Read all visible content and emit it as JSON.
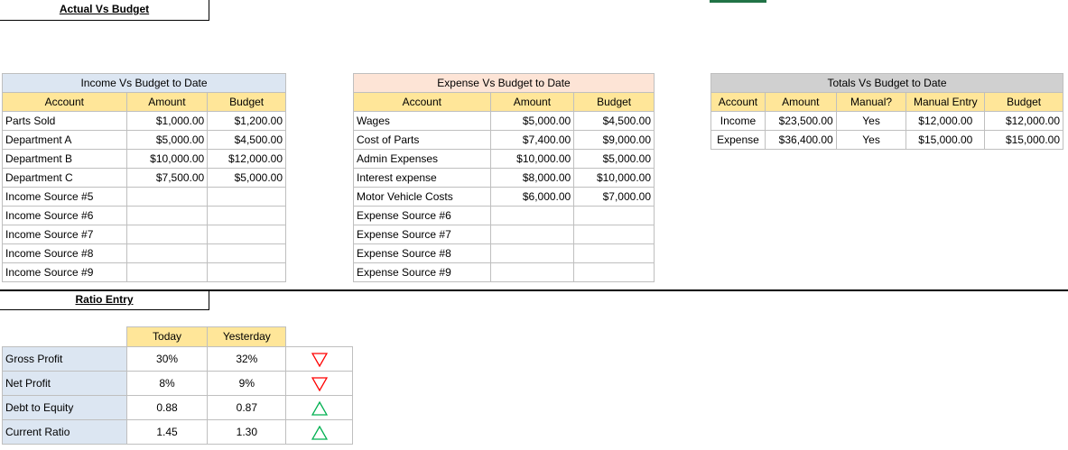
{
  "titles": {
    "actual_vs_budget": "Actual Vs Budget",
    "ratio_entry": "Ratio Entry"
  },
  "income": {
    "title": "Income Vs Budget to Date",
    "headers": [
      "Account",
      "Amount",
      "Budget"
    ],
    "rows": [
      [
        "Parts Sold",
        "$1,000.00",
        "$1,200.00"
      ],
      [
        "Department A",
        "$5,000.00",
        "$4,500.00"
      ],
      [
        "Department B",
        "$10,000.00",
        "$12,000.00"
      ],
      [
        "Department C",
        "$7,500.00",
        "$5,000.00"
      ],
      [
        "Income Source #5",
        "",
        ""
      ],
      [
        "Income Source #6",
        "",
        ""
      ],
      [
        "Income Source #7",
        "",
        ""
      ],
      [
        "Income Source #8",
        "",
        ""
      ],
      [
        "Income Source #9",
        "",
        ""
      ]
    ]
  },
  "expense": {
    "title": "Expense Vs Budget to Date",
    "headers": [
      "Account",
      "Amount",
      "Budget"
    ],
    "rows": [
      [
        "Wages",
        "$5,000.00",
        "$4,500.00"
      ],
      [
        "Cost of Parts",
        "$7,400.00",
        "$9,000.00"
      ],
      [
        "Admin Expenses",
        "$10,000.00",
        "$5,000.00"
      ],
      [
        "Interest expense",
        "$8,000.00",
        "$10,000.00"
      ],
      [
        "Motor Vehicle Costs",
        "$6,000.00",
        "$7,000.00"
      ],
      [
        "Expense Source #6",
        "",
        ""
      ],
      [
        "Expense Source #7",
        "",
        ""
      ],
      [
        "Expense Source #8",
        "",
        ""
      ],
      [
        "Expense Source #9",
        "",
        ""
      ]
    ]
  },
  "totals": {
    "title": "Totals Vs Budget to Date",
    "headers": [
      "Account",
      "Amount",
      "Manual?",
      "Manual Entry",
      "Budget"
    ],
    "rows": [
      [
        "Income",
        "$23,500.00",
        "Yes",
        "$12,000.00",
        "$12,000.00"
      ],
      [
        "Expense",
        "$36,400.00",
        "Yes",
        "$15,000.00",
        "$15,000.00"
      ]
    ]
  },
  "ratios": {
    "headers": [
      "Today",
      "Yesterday"
    ],
    "rows": [
      {
        "label": "Gross Profit",
        "today": "30%",
        "yesterday": "32%",
        "trend": "down"
      },
      {
        "label": "Net Profit",
        "today": "8%",
        "yesterday": "9%",
        "trend": "down"
      },
      {
        "label": "Debt to Equity",
        "today": "0.88",
        "yesterday": "0.87",
        "trend": "up"
      },
      {
        "label": "Current Ratio",
        "today": "1.45",
        "yesterday": "1.30",
        "trend": "up"
      }
    ]
  },
  "colors": {
    "trend_down": "#ff0000",
    "trend_up": "#00b050",
    "header_yellow": "#ffe699",
    "income_blue": "#dce6f2",
    "expense_pink": "#fde4d6",
    "totals_gray": "#d0d0d0"
  }
}
